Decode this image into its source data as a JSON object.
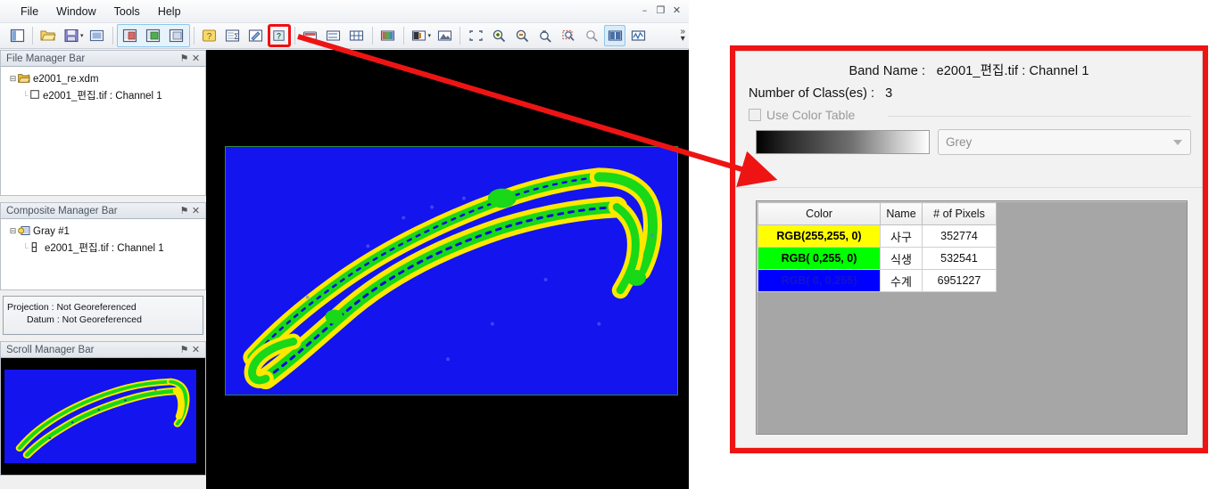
{
  "window": {
    "minimize_label": "–",
    "restore_label": "❐",
    "close_label": "✕"
  },
  "menubar": {
    "items": [
      {
        "label": "File"
      },
      {
        "label": "Window"
      },
      {
        "label": "Tools"
      },
      {
        "label": "Help"
      }
    ]
  },
  "toolbar": {
    "overflow_label": "»",
    "overflow_caret": "▾",
    "buttons": [
      {
        "name": "new-window-icon",
        "glyph": "▣"
      },
      {
        "name": "open-folder-icon",
        "glyph": "🗁"
      },
      {
        "name": "save-icon",
        "glyph": "💾"
      },
      {
        "name": "save-dropdown-caret",
        "glyph": "▾"
      },
      {
        "name": "new-view-icon",
        "glyph": "▢"
      },
      {
        "name": "file-manager-bar-icon",
        "glyph": "▤"
      },
      {
        "name": "composite-manager-bar-icon",
        "glyph": "▥"
      },
      {
        "name": "scroll-manager-bar-icon",
        "glyph": "▦"
      },
      {
        "name": "help-question-icon",
        "glyph": "?"
      },
      {
        "name": "statistics-sigma-icon",
        "glyph": "Σ"
      },
      {
        "name": "edit-table-icon",
        "glyph": "✎"
      },
      {
        "name": "class-info-question-icon",
        "glyph": "?"
      },
      {
        "name": "color-ramp-icon",
        "glyph": "▬"
      },
      {
        "name": "histogram-match-icon",
        "glyph": "▨"
      },
      {
        "name": "grid-icon",
        "glyph": "⊞"
      },
      {
        "name": "palette-icon",
        "glyph": "■"
      },
      {
        "name": "contrast-icon",
        "glyph": "◧"
      },
      {
        "name": "contrast-dropdown-caret",
        "glyph": "▾"
      },
      {
        "name": "image-enhance-icon",
        "glyph": "▲"
      },
      {
        "name": "fit-to-window-icon",
        "glyph": "⛶"
      },
      {
        "name": "zoom-in-icon",
        "glyph": "⊕"
      },
      {
        "name": "zoom-out-icon",
        "glyph": "⊖"
      },
      {
        "name": "zoom-free-icon",
        "glyph": "⌕"
      },
      {
        "name": "zoom-to-box-icon",
        "glyph": "⬚"
      },
      {
        "name": "pan-icon",
        "glyph": "✋"
      },
      {
        "name": "link-views-icon",
        "glyph": "◫"
      },
      {
        "name": "profile-chart-icon",
        "glyph": "〰"
      }
    ],
    "highlighted_button": "class-info-question-icon"
  },
  "panels": {
    "file_manager": {
      "title": "File Manager Bar",
      "pin_glyph": "⚑",
      "close_glyph": "✕",
      "tree": [
        {
          "expander": "⊟",
          "icon": "open-folder-icon",
          "label": "e2001_re.xdm",
          "children": [
            {
              "expander": "└",
              "icon": "checkbox-empty-icon",
              "label": "e2001_편집.tif : Channel 1"
            }
          ]
        }
      ]
    },
    "composite_manager": {
      "title": "Composite Manager Bar",
      "pin_glyph": "⚑",
      "close_glyph": "✕",
      "tree": [
        {
          "expander": "⊟",
          "icon": "gray-composite-icon",
          "label": "Gray #1",
          "children": [
            {
              "expander": "└",
              "icon": "band-icon",
              "label": "e2001_편집.tif : Channel 1"
            }
          ]
        }
      ]
    },
    "projection_info": {
      "line1": "Projection : Not Georeferenced",
      "line2": "Datum : Not Georeferenced"
    },
    "scroll_manager": {
      "title": "Scroll Manager Bar",
      "pin_glyph": "⚑",
      "close_glyph": "✕"
    }
  },
  "class_info_dialog": {
    "band_name_label": "Band Name :",
    "band_name_value": "e2001_편집.tif : Channel 1",
    "num_classes_label": "Number of Class(es) :",
    "num_classes_value": "3",
    "use_color_table_label": "Use Color Table",
    "use_color_table_checked": false,
    "colormap_value": "Grey",
    "table": {
      "headers": [
        "Color",
        "Name",
        "# of Pixels"
      ],
      "rows": [
        {
          "color_text": "RGB(255,255,  0)",
          "color_hex": "#FFFF00",
          "text_hex": "#000000",
          "name": "사구",
          "pixels": "352774"
        },
        {
          "color_text": "RGB(  0,255,  0)",
          "color_hex": "#00FF00",
          "text_hex": "#000000",
          "name": "식생",
          "pixels": "532541"
        },
        {
          "color_text": "RGB(  0,  0,255)",
          "color_hex": "#0000FF",
          "text_hex": "#1212CC",
          "name": "수계",
          "pixels": "6951227"
        }
      ]
    }
  },
  "annotation": {
    "arrow_color": "#ee1414",
    "highlight_box_color": "#ee1111",
    "panel_border_color": "#ee1414"
  }
}
